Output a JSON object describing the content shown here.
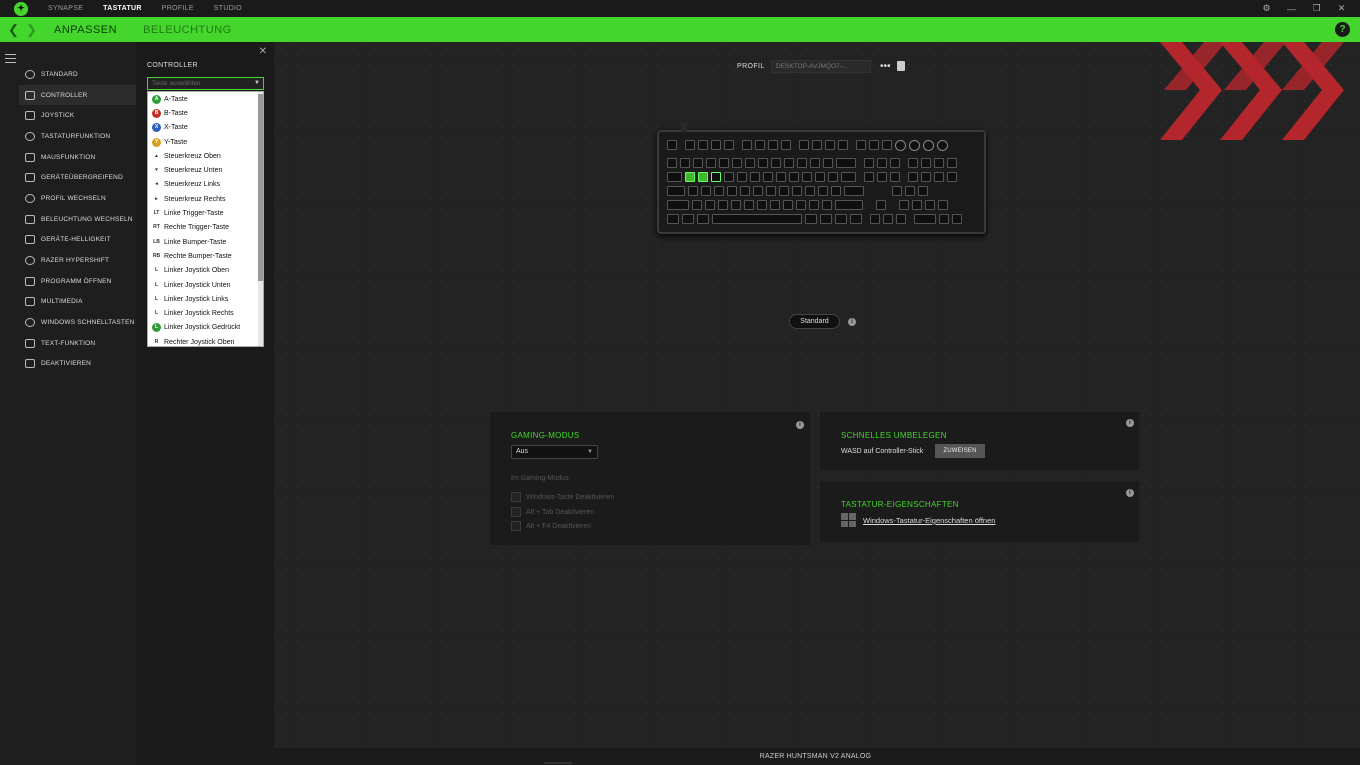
{
  "titlebar": {
    "tabs": [
      "SYNAPSE",
      "TASTATUR",
      "PROFILE",
      "STUDIO"
    ],
    "active_tab": "TASTATUR"
  },
  "subnav": {
    "tab1": "ANPASSEN",
    "tab2": "BELEUCHTUNG",
    "help": "?"
  },
  "sidebar": {
    "items": [
      {
        "label": "STANDARD",
        "icon": "refresh-icon"
      },
      {
        "label": "CONTROLLER",
        "icon": "gamepad-icon"
      },
      {
        "label": "JOYSTICK",
        "icon": "joystick-icon"
      },
      {
        "label": "TASTATURFUNKTION",
        "icon": "keyboard-icon"
      },
      {
        "label": "MAUSFUNKTION",
        "icon": "mouse-icon"
      },
      {
        "label": "GERÄTEÜBERGREIFEND",
        "icon": "cross-device-icon"
      },
      {
        "label": "PROFIL WECHSELN",
        "icon": "switch-icon"
      },
      {
        "label": "BELEUCHTUNG WECHSELN",
        "icon": "lighting-icon"
      },
      {
        "label": "GERÄTE-HELLIGKEIT",
        "icon": "brightness-icon"
      },
      {
        "label": "RAZER HYPERSHIFT",
        "icon": "hypershift-icon"
      },
      {
        "label": "PROGRAMM ÖFFNEN",
        "icon": "program-icon"
      },
      {
        "label": "MULTIMEDIA",
        "icon": "multimedia-icon"
      },
      {
        "label": "WINDOWS SCHNELLTASTEN",
        "icon": "shortcut-icon"
      },
      {
        "label": "TEXT-FUNKTION",
        "icon": "text-icon"
      },
      {
        "label": "DEAKTIVIEREN",
        "icon": "disable-icon"
      }
    ],
    "active_index": 1
  },
  "controller": {
    "title": "CONTROLLER",
    "placeholder": "Taste auswählen",
    "options": [
      {
        "label": "A-Taste",
        "badge": "A",
        "color": "#2e9a3a"
      },
      {
        "label": "B-Taste",
        "badge": "B",
        "color": "#c0302a"
      },
      {
        "label": "X-Taste",
        "badge": "X",
        "color": "#2a5fc0"
      },
      {
        "label": "Y-Taste",
        "badge": "Y",
        "color": "#d6a21c"
      },
      {
        "label": "Steuerkreuz Oben",
        "badge": "▴",
        "color": ""
      },
      {
        "label": "Steuerkreuz Unten",
        "badge": "▾",
        "color": ""
      },
      {
        "label": "Steuerkreuz Links",
        "badge": "◂",
        "color": ""
      },
      {
        "label": "Steuerkreuz Rechts",
        "badge": "▸",
        "color": ""
      },
      {
        "label": "Linke Trigger-Taste",
        "badge": "LT",
        "color": ""
      },
      {
        "label": "Rechte Trigger-Taste",
        "badge": "RT",
        "color": ""
      },
      {
        "label": "Linke Bumper-Taste",
        "badge": "LB",
        "color": ""
      },
      {
        "label": "Rechte Bumper-Taste",
        "badge": "RB",
        "color": ""
      },
      {
        "label": "Linker Joystick Oben",
        "badge": "L",
        "color": ""
      },
      {
        "label": "Linker Joystick Unten",
        "badge": "L",
        "color": ""
      },
      {
        "label": "Linker Joystick Links",
        "badge": "L",
        "color": ""
      },
      {
        "label": "Linker Joystick Rechts",
        "badge": "L",
        "color": ""
      },
      {
        "label": "Linker Joystick Gedrückt",
        "badge": "L",
        "color": "#2e9a3a"
      },
      {
        "label": "Rechter Joystick Oben",
        "badge": "R",
        "color": ""
      }
    ]
  },
  "profile": {
    "label": "PROFIL",
    "value": "DESKTOP-AVJMQO7-...",
    "more": "•••"
  },
  "standard_badge": "Standard",
  "gaming_mode": {
    "title": "GAMING-MODUS",
    "value": "Aus",
    "subtitle": "Im Gaming-Modus:",
    "options": [
      "Windows-Taste Deaktivieren",
      "Alt + Tab Deaktivieren",
      "Alt + F4 Deaktivieren"
    ]
  },
  "quick_remap": {
    "title": "SCHNELLES UMBELEGEN",
    "text": "WASD auf Controller-Stick",
    "button": "ZUWEISEN"
  },
  "keyboard_props": {
    "title": "TASTATUR-EIGENSCHAFTEN",
    "link": "Windows-Tastatur-Eigenschaften öffnen"
  },
  "footer": {
    "device": "RAZER HUNTSMAN V2 ANALOG"
  },
  "colors": {
    "accent": "#44d62c",
    "watermark": "#c0272d"
  }
}
